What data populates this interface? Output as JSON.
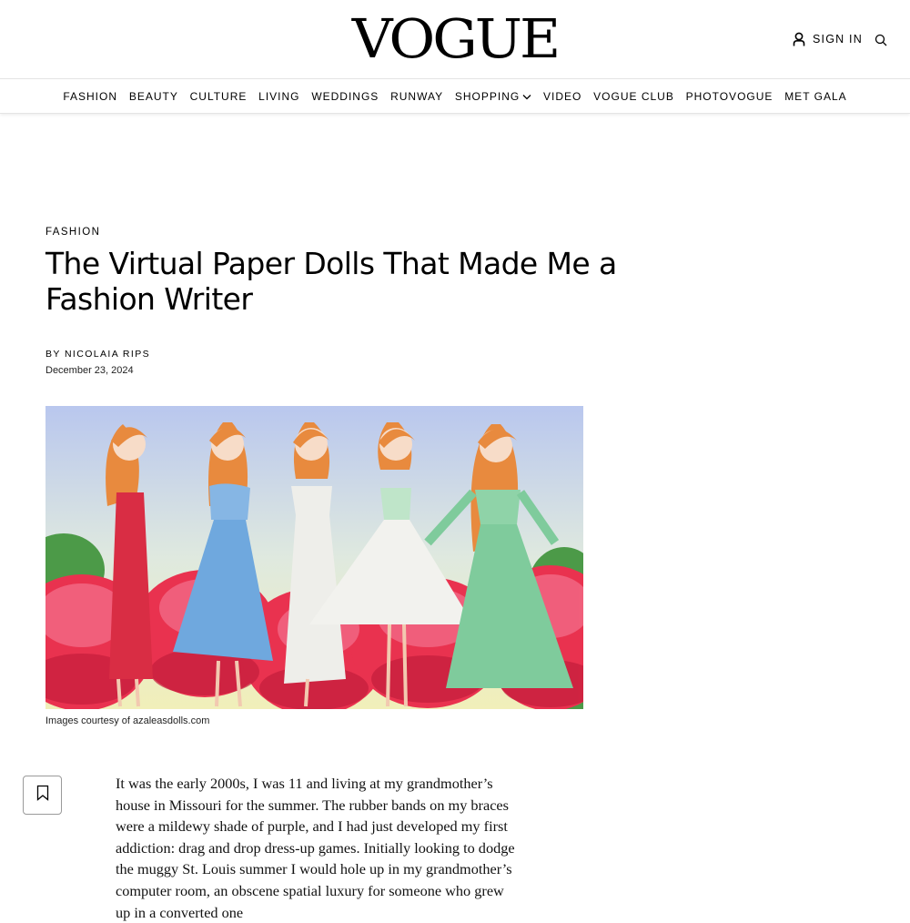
{
  "header": {
    "logo": "VOGUE",
    "sign_in_label": "SIGN IN",
    "icons": {
      "user": "user-icon",
      "search": "search-icon"
    }
  },
  "nav": {
    "items": [
      {
        "label": "FASHION"
      },
      {
        "label": "BEAUTY"
      },
      {
        "label": "CULTURE"
      },
      {
        "label": "LIVING"
      },
      {
        "label": "WEDDINGS"
      },
      {
        "label": "RUNWAY"
      },
      {
        "label": "SHOPPING",
        "has_dropdown": true
      },
      {
        "label": "VIDEO"
      },
      {
        "label": "VOGUE CLUB"
      },
      {
        "label": "PHOTOVOGUE"
      },
      {
        "label": "MET GALA"
      }
    ]
  },
  "article": {
    "rubric": "FASHION",
    "title": "The Virtual Paper Dolls That Made Me a Fashion Writer",
    "byline_prefix": "BY ",
    "author": "NICOLAIA RIPS",
    "date": "December 23, 2024",
    "image_caption": "Images courtesy of azaleasdolls.com",
    "hero_image": {
      "description_icon": "illustration-five-dolls-on-flowers",
      "dress_colors": [
        "#d92d44",
        "#6fa8de",
        "#eeeeea",
        "#f2f2ee",
        "#7fcb9c"
      ]
    },
    "body_paragraph": "It was the early 2000s, I was 11 and living at my grandmother’s house in Missouri for the summer. The rubber bands on my braces were a mildewy shade of purple, and I had just developed my first addiction: drag and drop dress-up games. Initially looking to dodge the muggy St. Louis summer I would hole up in my grandmother’s computer room, an obscene spatial luxury for someone who grew up in a converted one"
  },
  "save_button": {
    "icon": "bookmark-icon"
  }
}
